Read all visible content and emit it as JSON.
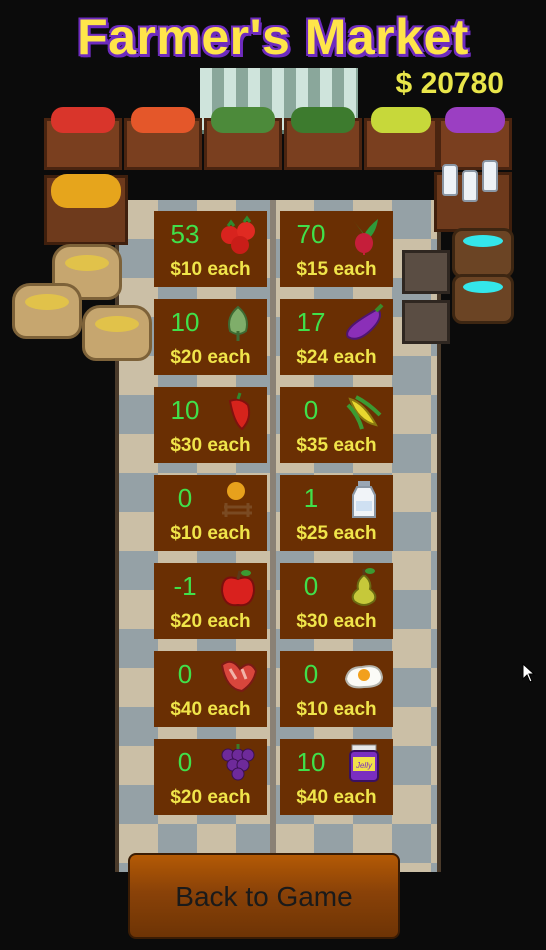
{
  "header": {
    "title": "Farmer's Market",
    "money": "$ 20780"
  },
  "items": [
    {
      "qty": "53",
      "price": "$10 each",
      "icon": "tomato-icon"
    },
    {
      "qty": "70",
      "price": "$15 each",
      "icon": "radish-icon"
    },
    {
      "qty": "10",
      "price": "$20 each",
      "icon": "artichoke-icon"
    },
    {
      "qty": "17",
      "price": "$24 each",
      "icon": "eggplant-icon"
    },
    {
      "qty": "10",
      "price": "$30 each",
      "icon": "pepper-icon"
    },
    {
      "qty": "0",
      "price": "$35 each",
      "icon": "corn-icon"
    },
    {
      "qty": "0",
      "price": "$10 each",
      "icon": "wheat-icon"
    },
    {
      "qty": "1",
      "price": "$25 each",
      "icon": "milk-bottle-icon"
    },
    {
      "qty": "-1",
      "price": "$20 each",
      "icon": "apple-icon"
    },
    {
      "qty": "0",
      "price": "$30 each",
      "icon": "pear-icon"
    },
    {
      "qty": "0",
      "price": "$40 each",
      "icon": "meat-icon"
    },
    {
      "qty": "0",
      "price": "$10 each",
      "icon": "fried-egg-icon"
    },
    {
      "qty": "0",
      "price": "$20 each",
      "icon": "grapes-icon"
    },
    {
      "qty": "10",
      "price": "$40 each",
      "icon": "jelly-jar-icon",
      "icon_text": "Jelly"
    }
  ],
  "footer": {
    "back_label": "Back to Game"
  },
  "colors": {
    "title": "#ffe54a",
    "title_outline": "#6e2bbf",
    "money": "#e9e64a",
    "tile_bg": "#6a2f03",
    "qty": "#40e04a",
    "price": "#f0e54a"
  }
}
